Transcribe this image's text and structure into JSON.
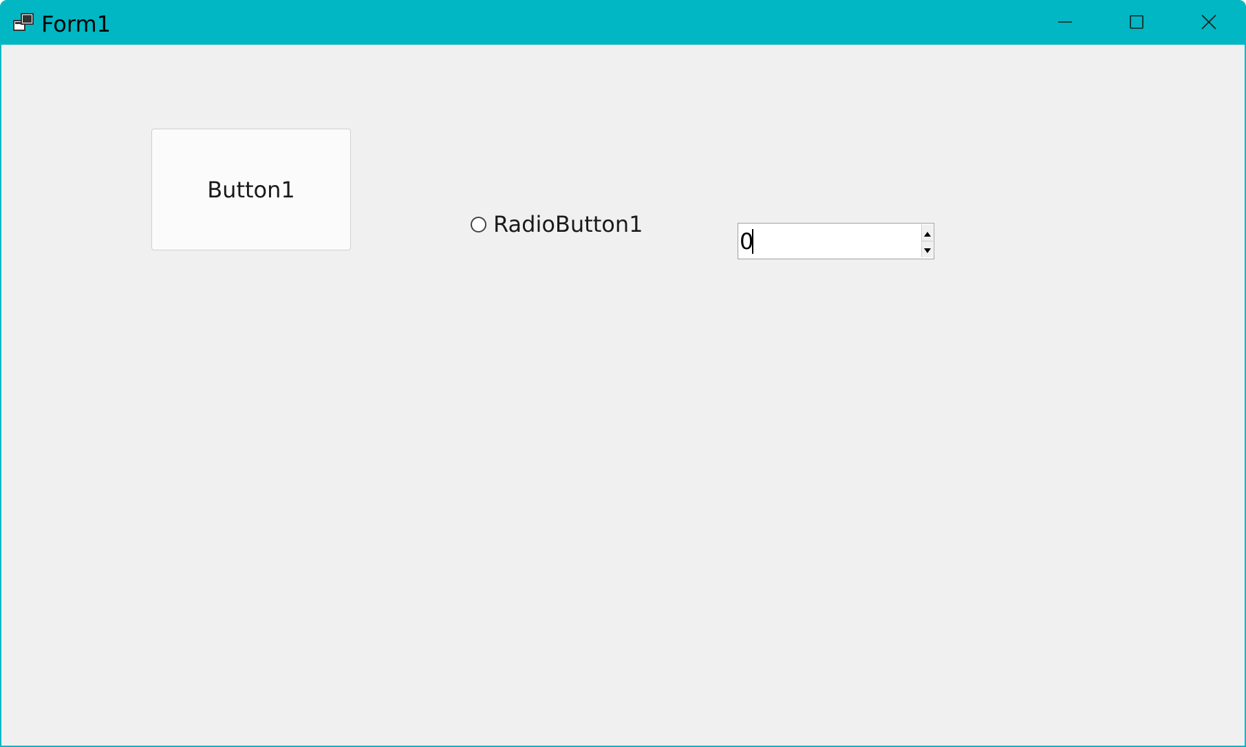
{
  "window": {
    "title": "Form1",
    "accent_color": "#00b7c3",
    "app_icon": "form-window-icon"
  },
  "caption_buttons": {
    "minimize_icon": "minimize-icon",
    "maximize_icon": "maximize-icon",
    "close_icon": "close-icon"
  },
  "form": {
    "button1_label": "Button1",
    "radio_label": "RadioButton1",
    "radio_checked": false,
    "numeric_value": "0"
  }
}
